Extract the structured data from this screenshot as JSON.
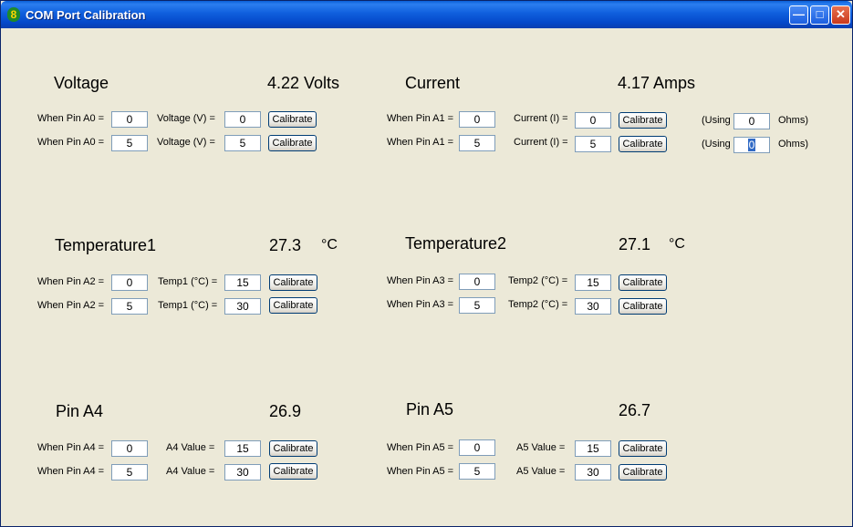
{
  "window": {
    "title": "COM Port Calibration"
  },
  "voltage": {
    "title": "Voltage",
    "reading": "4.22 Volts",
    "rows": [
      {
        "pin_label": "When Pin A0 =",
        "pin_value": "0",
        "val_label": "Voltage (V) =",
        "value": "0",
        "button": "Calibrate"
      },
      {
        "pin_label": "When Pin A0 =",
        "pin_value": "5",
        "val_label": "Voltage (V) =",
        "value": "5",
        "button": "Calibrate"
      }
    ]
  },
  "current": {
    "title": "Current",
    "reading": "4.17 Amps",
    "rows": [
      {
        "pin_label": "When Pin A1 =",
        "pin_value": "0",
        "val_label": "Current (I) =",
        "value": "0",
        "button": "Calibrate",
        "using_label": "(Using",
        "ohms_value": "0",
        "ohms_label": "Ohms)"
      },
      {
        "pin_label": "When Pin A1 =",
        "pin_value": "5",
        "val_label": "Current (I) =",
        "value": "5",
        "button": "Calibrate",
        "using_label": "(Using",
        "ohms_value": "0",
        "ohms_label": "Ohms)"
      }
    ]
  },
  "temp1": {
    "title": "Temperature1",
    "reading": "27.3",
    "unit": "°C",
    "rows": [
      {
        "pin_label": "When Pin A2 =",
        "pin_value": "0",
        "val_label": "Temp1 (°C) =",
        "value": "15",
        "button": "Calibrate"
      },
      {
        "pin_label": "When Pin A2 =",
        "pin_value": "5",
        "val_label": "Temp1 (°C) =",
        "value": "30",
        "button": "Calibrate"
      }
    ]
  },
  "temp2": {
    "title": "Temperature2",
    "reading": "27.1",
    "unit": "°C",
    "rows": [
      {
        "pin_label": "When Pin A3 =",
        "pin_value": "0",
        "val_label": "Temp2 (°C) =",
        "value": "15",
        "button": "Calibrate"
      },
      {
        "pin_label": "When Pin A3 =",
        "pin_value": "5",
        "val_label": "Temp2 (°C) =",
        "value": "30",
        "button": "Calibrate"
      }
    ]
  },
  "pina4": {
    "title": "Pin A4",
    "reading": "26.9",
    "rows": [
      {
        "pin_label": "When Pin A4 =",
        "pin_value": "0",
        "val_label": "A4 Value =",
        "value": "15",
        "button": "Calibrate"
      },
      {
        "pin_label": "When Pin A4 =",
        "pin_value": "5",
        "val_label": "A4 Value =",
        "value": "30",
        "button": "Calibrate"
      }
    ]
  },
  "pina5": {
    "title": "Pin A5",
    "reading": "26.7",
    "rows": [
      {
        "pin_label": "When Pin A5 =",
        "pin_value": "0",
        "val_label": "A5 Value =",
        "value": "15",
        "button": "Calibrate"
      },
      {
        "pin_label": "When Pin A5 =",
        "pin_value": "5",
        "val_label": "A5 Value =",
        "value": "30",
        "button": "Calibrate"
      }
    ]
  }
}
